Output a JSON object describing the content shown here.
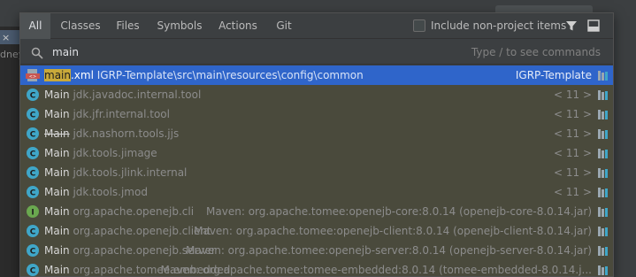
{
  "tabs": [
    {
      "label": "All",
      "active": true
    },
    {
      "label": "Classes",
      "active": false
    },
    {
      "label": "Files",
      "active": false
    },
    {
      "label": "Symbols",
      "active": false
    },
    {
      "label": "Actions",
      "active": false
    },
    {
      "label": "Git",
      "active": false
    }
  ],
  "include_label": "Include non-project items",
  "search": {
    "value": "main",
    "hint": "Type / to see commands"
  },
  "backdrop": {
    "left_text": "dney"
  },
  "results": [
    {
      "icon": "xml-file-icon",
      "match": "main",
      "name": ".xml",
      "location": " IGRP-Template\\src\\main\\resources\\config\\common",
      "right": "IGRP-Template",
      "selected": true,
      "strike": false
    },
    {
      "icon": "class-icon",
      "match": "",
      "name": "Main",
      "location": " jdk.javadoc.internal.tool",
      "right": "< 11 >",
      "selected": false,
      "strike": false
    },
    {
      "icon": "class-icon",
      "match": "",
      "name": "Main",
      "location": " jdk.jfr.internal.tool",
      "right": "< 11 >",
      "selected": false,
      "strike": false
    },
    {
      "icon": "class-icon",
      "match": "",
      "name": "Main",
      "location": " jdk.nashorn.tools.jjs",
      "right": "< 11 >",
      "selected": false,
      "strike": true
    },
    {
      "icon": "class-icon",
      "match": "",
      "name": "Main",
      "location": " jdk.tools.jimage",
      "right": "< 11 >",
      "selected": false,
      "strike": false
    },
    {
      "icon": "class-icon",
      "match": "",
      "name": "Main",
      "location": " jdk.tools.jlink.internal",
      "right": "< 11 >",
      "selected": false,
      "strike": false
    },
    {
      "icon": "class-icon",
      "match": "",
      "name": "Main",
      "location": " jdk.tools.jmod",
      "right": "< 11 >",
      "selected": false,
      "strike": false
    },
    {
      "icon": "interface-icon",
      "match": "",
      "name": "Main",
      "location": " org.apache.openejb.cli",
      "right": "Maven: org.apache.tomee:openejb-core:8.0.14 (openejb-core-8.0.14.jar)",
      "selected": false,
      "strike": false
    },
    {
      "icon": "class-icon",
      "match": "",
      "name": "Main",
      "location": " org.apache.openejb.client",
      "right": "Maven: org.apache.tomee:openejb-client:8.0.14 (openejb-client-8.0.14.jar)",
      "selected": false,
      "strike": false
    },
    {
      "icon": "class-icon",
      "match": "",
      "name": "Main",
      "location": " org.apache.openejb.server",
      "right": "Maven: org.apache.tomee:openejb-server:8.0.14 (openejb-server-8.0.14.jar)",
      "selected": false,
      "strike": false
    },
    {
      "icon": "class-icon",
      "match": "",
      "name": "Main",
      "location": " org.apache.tomee.embedded",
      "right": "Maven: org.apache.tomee:tomee-embedded:8.0.14 (tomee-embedded-8.0.14.j...",
      "selected": false,
      "strike": false
    }
  ],
  "colors": {
    "accent": "#2f65ca",
    "highlight": "#c9a93a",
    "row_bg": "#4a4a3c",
    "class_icon": "#3fa6c8",
    "interface_icon": "#6aa84f"
  }
}
